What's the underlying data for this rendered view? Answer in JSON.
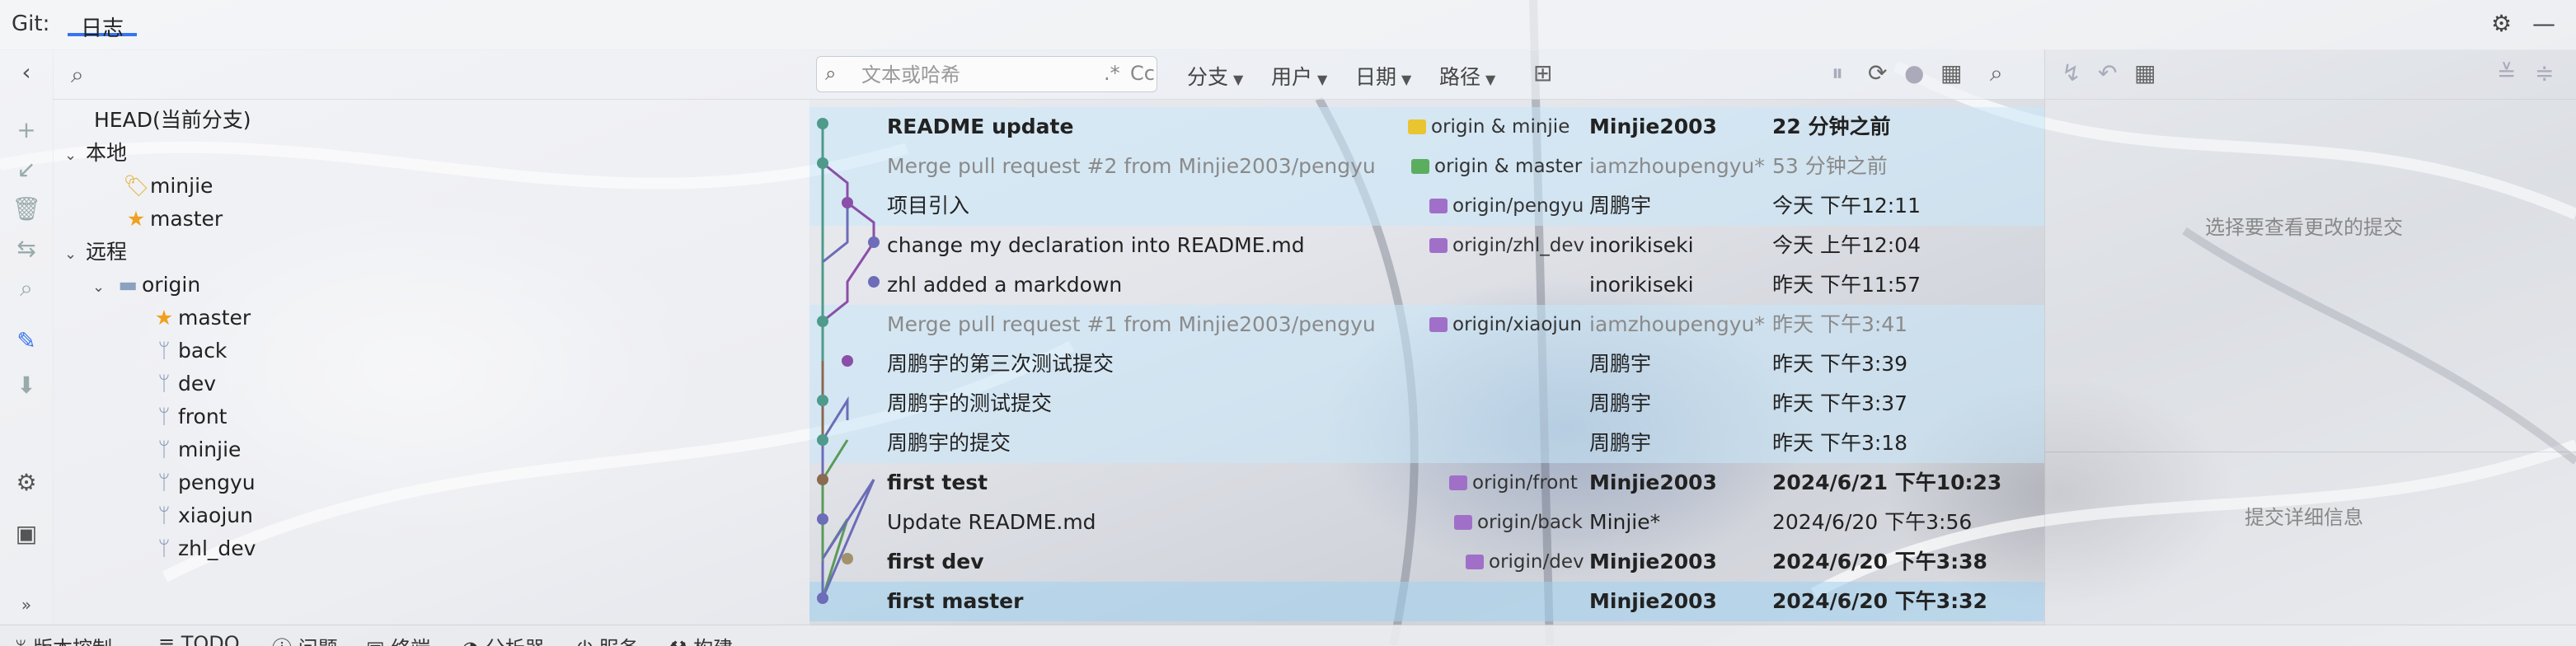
{
  "titlebar": {
    "label": "Git:",
    "tab": "日志",
    "settings_icon": "gear-icon",
    "minimize_icon": "minimize-icon"
  },
  "tree": {
    "search_icon": "search-icon",
    "head": "HEAD(当前分支)",
    "local_label": "本地",
    "local": [
      {
        "name": "minjie",
        "icon": "tag-icon"
      },
      {
        "name": "master",
        "icon": "star-icon"
      }
    ],
    "remote_label": "远程",
    "origin_label": "origin",
    "remote": [
      {
        "name": "master",
        "icon": "star-icon"
      },
      {
        "name": "back",
        "icon": "branch-icon"
      },
      {
        "name": "dev",
        "icon": "branch-icon"
      },
      {
        "name": "front",
        "icon": "branch-icon"
      },
      {
        "name": "minjie",
        "icon": "branch-icon"
      },
      {
        "name": "pengyu",
        "icon": "branch-icon"
      },
      {
        "name": "xiaojun",
        "icon": "branch-icon"
      },
      {
        "name": "zhl_dev",
        "icon": "branch-icon"
      }
    ]
  },
  "log": {
    "search_placeholder": "文本或哈希",
    "regex_opt": ".*",
    "case_opt": "Cc",
    "filters": [
      "分支",
      "用户",
      "日期",
      "路径"
    ],
    "commits": [
      {
        "msg": "README update",
        "ref": "origin & minjie",
        "tag_color": "#e9c531",
        "author": "Minjie2003",
        "date": "22 分钟之前",
        "style": "bold",
        "bg": "hl"
      },
      {
        "msg": "Merge pull request #2 from Minjie2003/pengyu",
        "ref": "origin & master",
        "tag_color": "#5cae5f",
        "author": "iamzhoupengyu*",
        "date": "53 分钟之前",
        "style": "grey",
        "bg": "hl"
      },
      {
        "msg": "项目引入",
        "ref": "origin/pengyu",
        "tag_color": "#a070c8",
        "author": "周鹏宇",
        "date": "今天 下午12:11",
        "style": "normal",
        "bg": "hl"
      },
      {
        "msg": "change my declaration into README.md",
        "ref": "origin/zhl_dev",
        "tag_color": "#a070c8",
        "author": "inorikiseki",
        "date": "今天 上午12:04",
        "style": "normal",
        "bg": ""
      },
      {
        "msg": "zhl added a markdown",
        "ref": "",
        "tag_color": "",
        "author": "inorikiseki",
        "date": "昨天 下午11:57",
        "style": "normal",
        "bg": ""
      },
      {
        "msg": "Merge pull request #1 from Minjie2003/pengyu",
        "ref": "origin/xiaojun",
        "tag_color": "#a070c8",
        "author": "iamzhoupengyu*",
        "date": "昨天 下午3:41",
        "style": "grey",
        "bg": "hl"
      },
      {
        "msg": "周鹏宇的第三次测试提交",
        "ref": "",
        "tag_color": "",
        "author": "周鹏宇",
        "date": "昨天 下午3:39",
        "style": "normal",
        "bg": "hl"
      },
      {
        "msg": "周鹏宇的测试提交",
        "ref": "",
        "tag_color": "",
        "author": "周鹏宇",
        "date": "昨天 下午3:37",
        "style": "normal",
        "bg": "hl"
      },
      {
        "msg": "周鹏宇的提交",
        "ref": "",
        "tag_color": "",
        "author": "周鹏宇",
        "date": "昨天 下午3:18",
        "style": "normal",
        "bg": "hl"
      },
      {
        "msg": "first test",
        "ref": "origin/front",
        "tag_color": "#a070c8",
        "author": "Minjie2003",
        "date": "2024/6/21 下午10:23",
        "style": "bold",
        "bg": ""
      },
      {
        "msg": "Update README.md",
        "ref": "origin/back",
        "tag_color": "#a070c8",
        "author": "Minjie*",
        "date": "2024/6/20 下午3:56",
        "style": "normal",
        "bg": ""
      },
      {
        "msg": "first dev",
        "ref": "origin/dev",
        "tag_color": "#a070c8",
        "author": "Minjie2003",
        "date": "2024/6/20 下午3:38",
        "style": "bold",
        "bg": ""
      },
      {
        "msg": "first master",
        "ref": "",
        "tag_color": "",
        "author": "Minjie2003",
        "date": "2024/6/20 下午3:32",
        "style": "bold",
        "bg": "sel"
      }
    ]
  },
  "details": {
    "select_hint": "选择要查看更改的提交",
    "detail_hint": "提交详细信息"
  },
  "statusbar": {
    "items": [
      "版本控制",
      "TODO",
      "问题",
      "终端",
      "分析器",
      "服务",
      "构建"
    ]
  },
  "colors": {
    "accent": "#3874f0",
    "graph_teal": "#4f9a8a",
    "graph_purple": "#8a4fa8",
    "graph_blue": "#6c6cb8",
    "graph_brown": "#8a6a50",
    "graph_green": "#5a9a5a"
  }
}
